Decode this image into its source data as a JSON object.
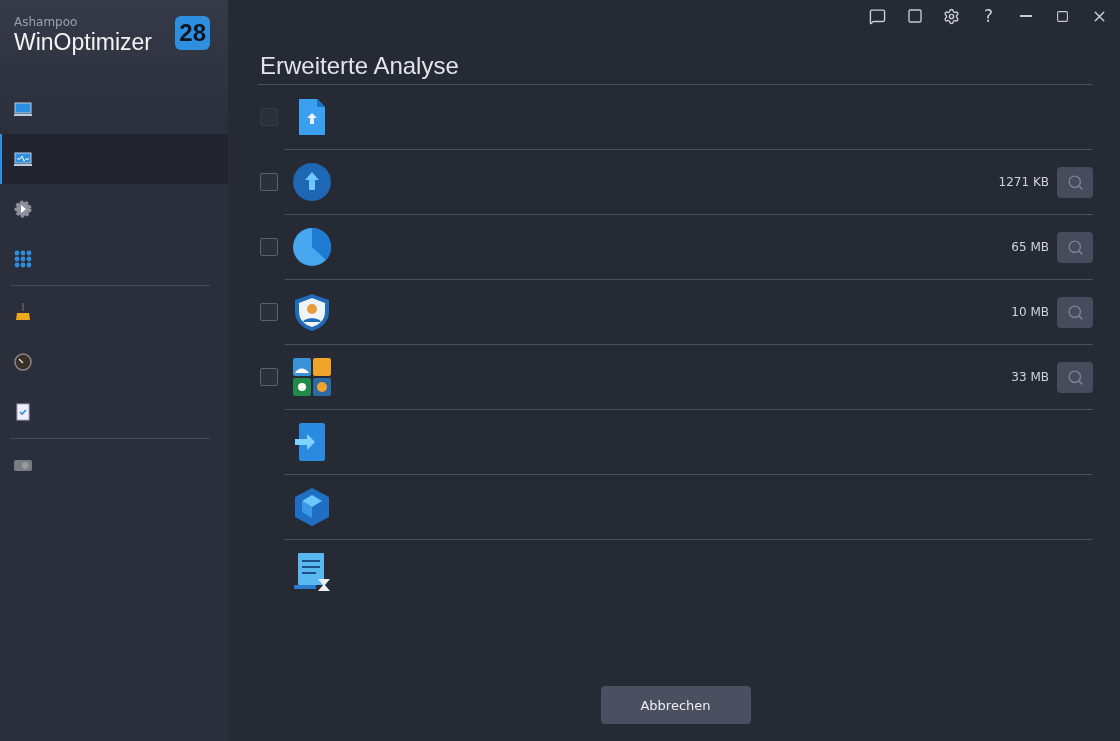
{
  "app": {
    "brand": "Ashampoo",
    "product": "WinOptimizer",
    "version": "28"
  },
  "titlebar": {
    "help": "?"
  },
  "sidebar": {
    "groups": [
      [
        {
          "selected": false
        },
        {
          "selected": true
        },
        {
          "selected": false
        },
        {
          "selected": false
        }
      ],
      [
        {
          "selected": false
        },
        {
          "selected": false
        },
        {
          "selected": false
        }
      ],
      [
        {
          "selected": false
        }
      ]
    ]
  },
  "main": {
    "title": "Erweiterte Analyse",
    "rows": [
      {
        "kind": "checkbox",
        "checked": false,
        "disabled": true
      },
      {
        "kind": "checkbox",
        "checked": false,
        "disabled": false,
        "size": "1271 KB"
      },
      {
        "kind": "checkbox",
        "checked": false,
        "disabled": false,
        "size": "65 MB"
      },
      {
        "kind": "checkbox",
        "checked": false,
        "disabled": false,
        "size": "10 MB"
      },
      {
        "kind": "checkbox",
        "checked": false,
        "disabled": false,
        "size": "33 MB"
      },
      {
        "kind": "plain"
      },
      {
        "kind": "plain"
      },
      {
        "kind": "plain"
      }
    ],
    "cancel": "Abbrechen"
  }
}
